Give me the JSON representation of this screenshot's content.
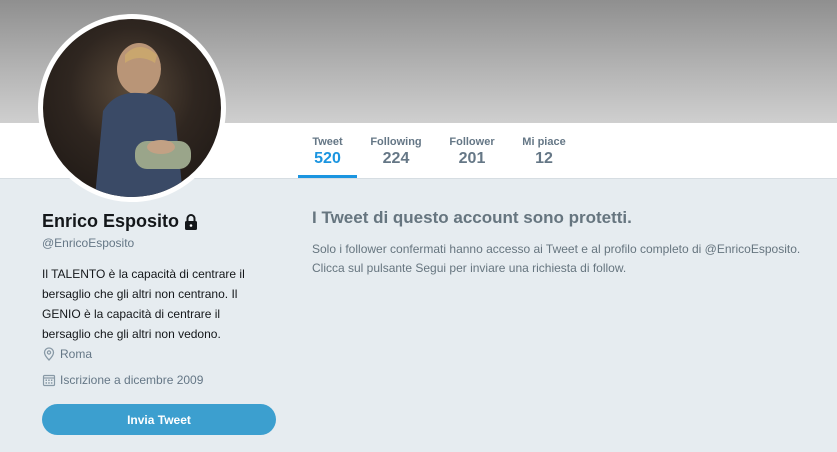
{
  "profile": {
    "name": "Enrico Esposito",
    "handle": "@EnricoEsposito",
    "bio": "Il TALENTO è la capacità di centrare il bersaglio che gli altri non centrano. Il GENIO è la capacità di centrare il bersaglio che gli altri non vedono.",
    "location": "Roma",
    "joined": "Iscrizione a dicembre 2009",
    "tweet_button": "Invia Tweet"
  },
  "stats": [
    {
      "label": "Tweet",
      "value": "520"
    },
    {
      "label": "Following",
      "value": "224"
    },
    {
      "label": "Follower",
      "value": "201"
    },
    {
      "label": "Mi piace",
      "value": "12"
    }
  ],
  "protected": {
    "title": "I Tweet di questo account sono protetti.",
    "description": "Solo i follower confermati hanno accesso ai Tweet e al profilo completo di @EnricoEsposito. Clicca sul pulsante Segui per inviare una richiesta di follow."
  },
  "colors": {
    "accent": "#1b95e0",
    "button": "#3c9fcf",
    "background": "#e6ecf0"
  },
  "icons": {
    "lock": "lock-icon",
    "location": "location-pin-icon",
    "calendar": "calendar-icon"
  }
}
